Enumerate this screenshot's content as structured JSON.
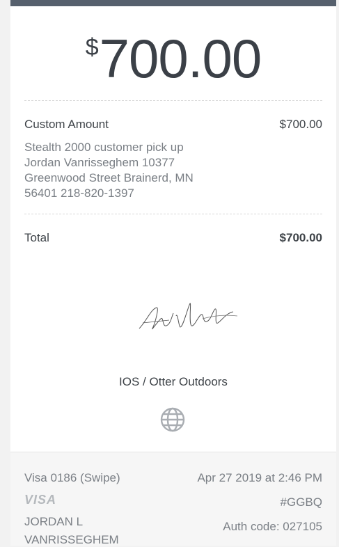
{
  "receipt": {
    "currency_symbol": "$",
    "amount": "700.00",
    "item_label": "Custom Amount",
    "item_amount": "$700.00",
    "note_lines": [
      "Stealth 2000 customer pick up",
      "Jordan Vanrisseghem 10377",
      "Greenwood Street Brainerd, MN",
      "56401 218-820-1397"
    ],
    "total_label": "Total",
    "total_amount": "$700.00",
    "merchant": "IOS / Otter Outdoors"
  },
  "footer": {
    "card": "Visa 0186 (Swipe)",
    "datetime": "Apr 27 2019 at 2:46 PM",
    "card_brand_logo": "VISA",
    "receipt_code": "#GGBQ",
    "cardholder_line1": "JORDAN L",
    "cardholder_line2": "VANRISSEGHEM",
    "auth_code": "Auth code: 027105"
  },
  "icons": {
    "globe": "globe-icon",
    "signature": "signature-image"
  },
  "colors": {
    "header_bar": "#56606d",
    "text_primary": "#3e4348",
    "text_secondary": "#7a7f85",
    "visa_logo": "#b5b9bd"
  }
}
